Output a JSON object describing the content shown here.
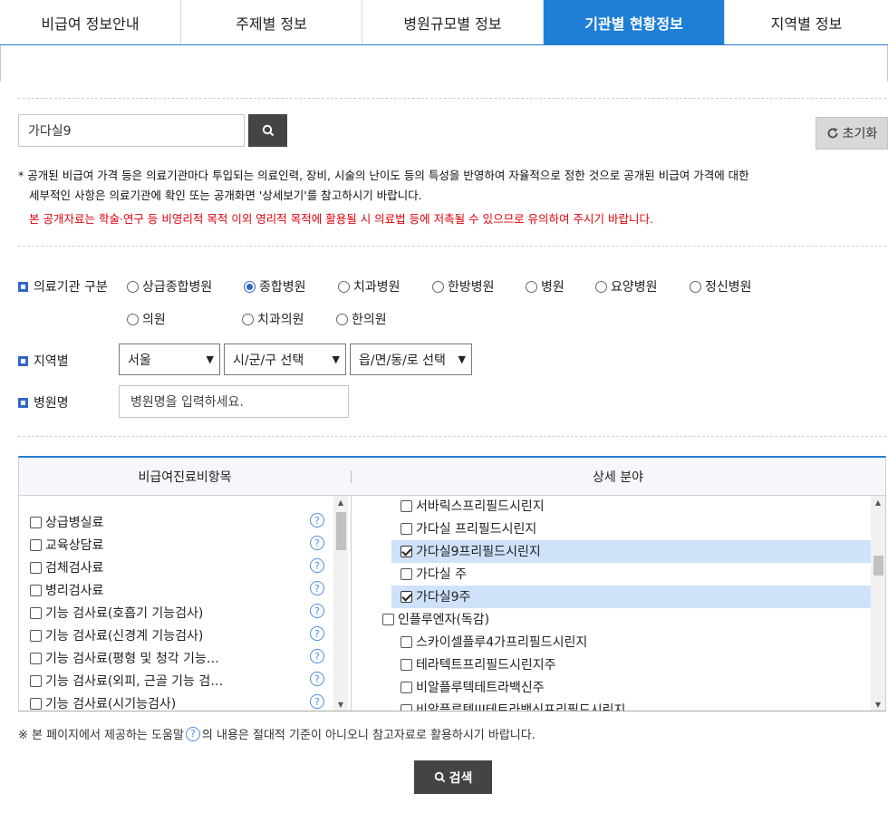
{
  "tabs": [
    "비급여 정보안내",
    "주제별 정보",
    "병원규모별 정보",
    "기관별 현황정보",
    "지역별 정보"
  ],
  "active_tab": 3,
  "search": {
    "value": "가다실9"
  },
  "reset_label": "초기화",
  "notice": {
    "line1": "* 공개된 비급여 가격 등은 의료기관마다 투입되는 의료인력, 장비, 시술의 난이도 등의 특성을 반영하여 자율적으로 정한 것으로 공개된 비급여 가격에 대한",
    "line2": "세부적인 사항은 의료기관에 확인 또는 공개화면 '상세보기'를 참고하시기 바랍니다.",
    "warning": "본 공개자료는 학술·연구 등 비영리적 목적 이외 영리적 목적에 활용될 시 의료법 등에 저촉될 수 있으므로 유의하여 주시기 바랍니다."
  },
  "institution_type": {
    "label": "의료기관 구분",
    "options": [
      "상급종합병원",
      "종합병원",
      "치과병원",
      "한방병원",
      "병원",
      "요양병원",
      "정신병원",
      "의원",
      "치과의원",
      "한의원"
    ],
    "selected": "종합병원"
  },
  "region": {
    "label": "지역별",
    "city": "서울",
    "district": "시/군/구 선택",
    "town": "읍/면/동/로 선택"
  },
  "hospital_name": {
    "label": "병원명",
    "placeholder": "병원명을 입력하세요."
  },
  "table": {
    "col_left": "비급여진료비항목",
    "col_right": "상세 분야",
    "left_items": [
      "상급병실료",
      "교육상담료",
      "검체검사료",
      "병리검사료",
      "기능 검사료(호흡기 기능검사)",
      "기능 검사료(신경계 기능검사)",
      "기능 검사료(평형 및 청각 기능…",
      "기능 검사료(외피, 근골 기능 검…",
      "기능 검사료(시기능검사)"
    ],
    "right_items": [
      {
        "label": "서바릭스프리필드시린지",
        "checked": false,
        "indent": 2
      },
      {
        "label": "가다실 프리필드시린지",
        "checked": false,
        "indent": 2
      },
      {
        "label": "가다실9프리필드시린지",
        "checked": true,
        "indent": 2
      },
      {
        "label": "가다실 주",
        "checked": false,
        "indent": 2
      },
      {
        "label": "가다실9주",
        "checked": true,
        "indent": 2
      },
      {
        "label": "인플루엔자(독감)",
        "checked": false,
        "indent": 1
      },
      {
        "label": "스카이셀플루4가프리필드시린지",
        "checked": false,
        "indent": 2
      },
      {
        "label": "테라텍트프리필드시린지주",
        "checked": false,
        "indent": 2
      },
      {
        "label": "비알플루텍테트라백신주",
        "checked": false,
        "indent": 2
      },
      {
        "label": "비알플루텍III테트라백신프리필드시린지",
        "checked": false,
        "indent": 2
      }
    ]
  },
  "footnote": {
    "before": "※ 본 페이지에서 제공하는 도움말",
    "after": "의 내용은 절대적 기준이 아니오니 참고자료로 활용하시기 바랍니다."
  },
  "help_glyph": "?",
  "search_button": "검색",
  "colors": {
    "tab_active": "#1f7fd6",
    "warning": "#e0000b",
    "highlight": "#cfe2fa"
  }
}
